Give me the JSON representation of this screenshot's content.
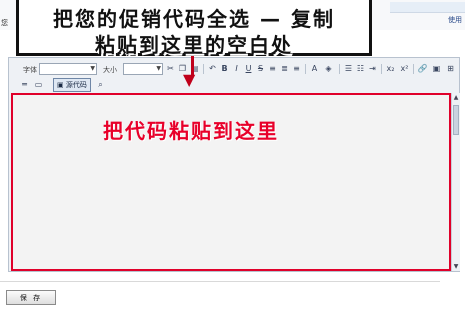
{
  "top": {
    "left_text_1": "您",
    "left_text_2": " ",
    "right_link": "使用"
  },
  "banner": {
    "line1": "把您的促销代码全选 — 复制",
    "line2": "粘贴到这里的空白处"
  },
  "toolbar": {
    "font_label": "字体",
    "size_label": "大小",
    "source_label": "源代码"
  },
  "content": {
    "text": "把代码粘贴到这里"
  },
  "footer": {
    "save_label": "保 存"
  },
  "colors": {
    "accent_red": "#e0002a",
    "frame": "#b8c2cf"
  }
}
